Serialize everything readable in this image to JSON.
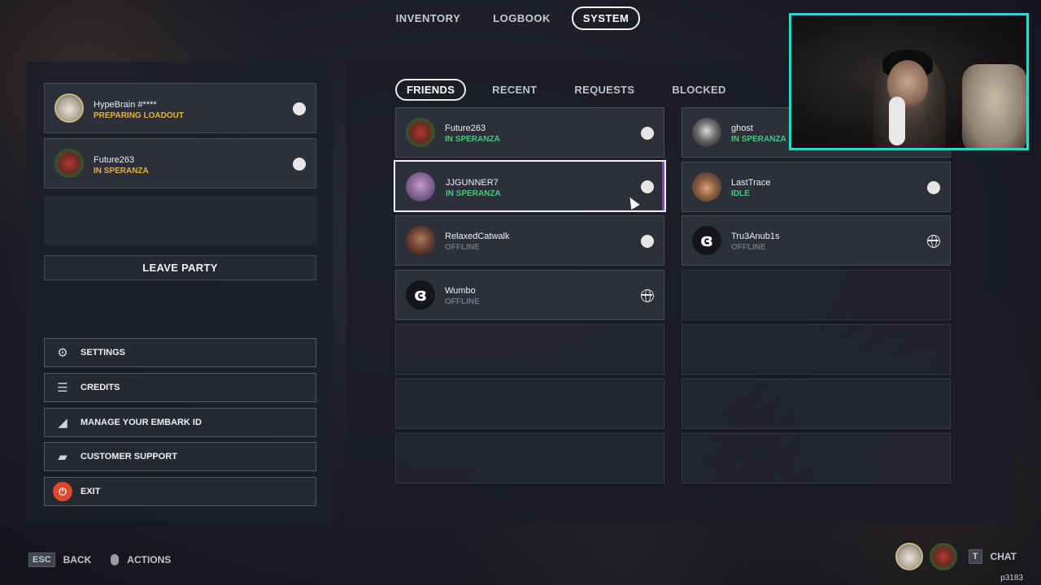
{
  "nav": {
    "tabs": [
      {
        "label": "INVENTORY"
      },
      {
        "label": "LOGBOOK"
      },
      {
        "label": "SYSTEM",
        "active": true
      }
    ]
  },
  "party": {
    "members": [
      {
        "name": "HypeBrain #****",
        "status": "PREPARING LOADOUT",
        "status_color": "#e8b23a",
        "platform_icon": "steam-icon"
      },
      {
        "name": "Future263",
        "status": "IN SPERANZA",
        "status_color": "#e8b23a",
        "platform_icon": "steam-icon"
      }
    ],
    "leave_label": "LEAVE PARTY"
  },
  "menu": {
    "items": [
      {
        "label": "SETTINGS",
        "icon": "gear-icon"
      },
      {
        "label": "CREDITS",
        "icon": "credits-icon"
      },
      {
        "label": "MANAGE YOUR EMBARK ID",
        "icon": "embark-id-icon"
      },
      {
        "label": "CUSTOMER SUPPORT",
        "icon": "chat-bubbles-icon"
      },
      {
        "label": "EXIT",
        "icon": "power-icon"
      }
    ]
  },
  "friends": {
    "tabs": [
      {
        "label": "FRIENDS",
        "active": true
      },
      {
        "label": "RECENT"
      },
      {
        "label": "REQUESTS"
      },
      {
        "label": "BLOCKED"
      }
    ],
    "list": [
      {
        "name": "Future263",
        "status": "IN SPERANZA",
        "status_color": "#3fcf7a",
        "platform_icon": "steam-icon"
      },
      {
        "name": "ghost",
        "status": "IN SPERANZA",
        "status_color": "#3fcf7a",
        "platform_icon": "steam-icon"
      },
      {
        "name": "JJGUNNER7",
        "status": "IN SPERANZA",
        "status_color": "#3fcf7a",
        "platform_icon": "steam-icon"
      },
      {
        "name": "LastTrace",
        "status": "IDLE",
        "status_color": "#3fcf7a",
        "platform_icon": "steam-icon"
      },
      {
        "name": "RelaxedCatwalk",
        "status": "OFFLINE",
        "status_color": "#6f7180",
        "platform_icon": "steam-icon"
      },
      {
        "name": "Tru3Anub1s",
        "status": "OFFLINE",
        "status_color": "#6f7180",
        "platform_icon": "globe-icon"
      },
      {
        "name": "Wumbo",
        "status": "OFFLINE",
        "status_color": "#6f7180",
        "platform_icon": "globe-icon"
      }
    ]
  },
  "footer": {
    "back_key": "ESC",
    "back_label": "BACK",
    "actions_label": "ACTIONS",
    "chat_key": "T",
    "chat_label": "CHAT",
    "player_id": "p3183"
  },
  "colors": {
    "accent_yellow": "#e8b23a",
    "accent_green": "#3fcf7a",
    "exit_red": "#e0452e",
    "webcam_border": "#2fd3d0"
  }
}
